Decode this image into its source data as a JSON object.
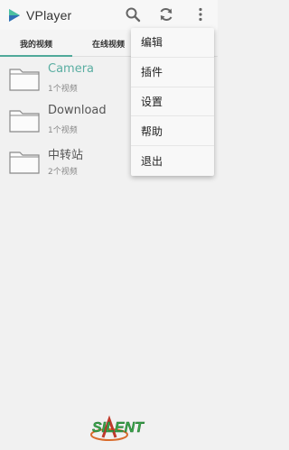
{
  "app": {
    "title": "VPlayer",
    "accent_color": "#4fa99a"
  },
  "toolbar": {
    "search_icon": "search-icon",
    "refresh_icon": "refresh-icon",
    "more_icon": "more-vertical-icon"
  },
  "tabs": [
    {
      "label": "我的视频",
      "selected": true
    },
    {
      "label": "在线视频",
      "selected": false
    }
  ],
  "folders": [
    {
      "name": "Camera",
      "count": "1个视频",
      "highlight": true
    },
    {
      "name": "Download",
      "count": "1个视频",
      "highlight": false
    },
    {
      "name": "中转站",
      "count": "2个视频",
      "highlight": false
    }
  ],
  "menu": {
    "items": [
      "编辑",
      "插件",
      "设置",
      "帮助",
      "退出"
    ]
  },
  "watermark": {
    "text": "SILENT"
  }
}
